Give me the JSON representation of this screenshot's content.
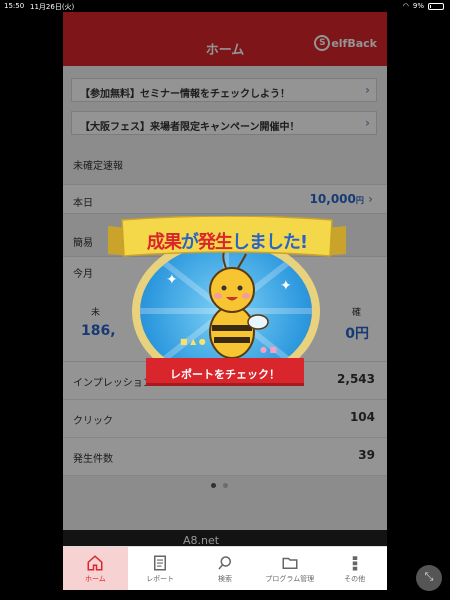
{
  "status": {
    "time": "15:50",
    "date": "11月26日(火)",
    "battery": "9%"
  },
  "header": {
    "title": "ホーム",
    "logo": "elfBack",
    "logo_initial": "S"
  },
  "banners": [
    {
      "text": "【参加無料】セミナー情報をチェックしよう！"
    },
    {
      "text": "【大阪フェス】来場者限定キャンペーン開催中！"
    }
  ],
  "unconfirmed": {
    "label": "未確定速報",
    "today_label": "本日",
    "today_value": "10,000",
    "unit": "円"
  },
  "summary": {
    "label_partial": "簡易",
    "month_label": "今月",
    "left_label_partial": "未",
    "left_value_partial": "186,",
    "right_label_partial": "確",
    "right_value_partial": "0円"
  },
  "stats": [
    {
      "label": "インプレッション",
      "value": "2,543"
    },
    {
      "label": "クリック",
      "value": "104"
    },
    {
      "label": "発生件数",
      "value": "39"
    }
  ],
  "ad": {
    "text": "A8.net"
  },
  "popup": {
    "title_a": "成果",
    "title_b": "が",
    "title_c": "発生",
    "title_d": "しました!",
    "button": "レポートをチェック！"
  },
  "tabs": [
    {
      "label": "ホーム",
      "icon": "home-icon",
      "active": true
    },
    {
      "label": "レポート",
      "icon": "report-icon"
    },
    {
      "label": "検索",
      "icon": "search-icon"
    },
    {
      "label": "プログラム管理",
      "icon": "folder-icon"
    },
    {
      "label": "その他",
      "icon": "more-icon"
    }
  ],
  "colors": {
    "brand_red": "#d9262c",
    "link_blue": "#2a64c8"
  }
}
